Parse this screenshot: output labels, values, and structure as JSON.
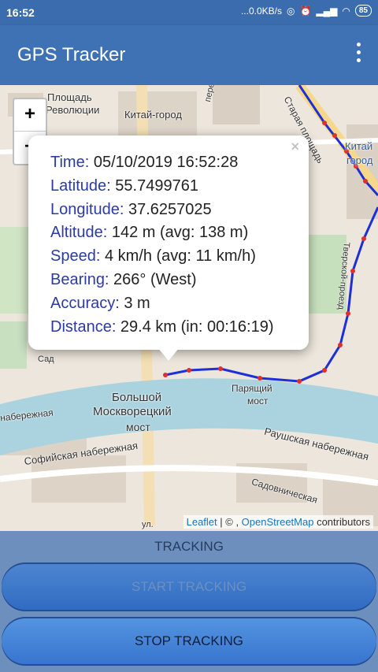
{
  "status_bar": {
    "time": "16:52",
    "net_speed": "...0.0KB/s",
    "battery": "85"
  },
  "app_bar": {
    "title": "GPS Tracker"
  },
  "map": {
    "zoom_in_label": "+",
    "zoom_out_label": "−",
    "labels": {
      "ploshchad": "Площадь",
      "revolyutsii": "Революции",
      "kitay_gorod": "Китай-город",
      "pereulok": "переулок",
      "staraya": "Старая площадь",
      "kitay_right": "Китай",
      "gorod_right": "город",
      "tversk": "Тверской-проезд",
      "sad": "Сад",
      "bolshoy": "Большой",
      "moskvoretsky": "Москворецкий",
      "most": "мост",
      "paryashchiy": "Парящий",
      "most2": "мост",
      "naberezhnaya_left": "набережная",
      "sofiyskaya": "Софийская набережная",
      "raushskaya": "Раушская набережная",
      "sadovnicheskaya": "Садовническая",
      "ulitsa": "ул."
    },
    "attribution": {
      "leaflet": "Leaflet",
      "separator": " | © , ",
      "osm": "OpenStreetMap",
      "contributors": " contributors"
    },
    "popup": {
      "close": "×",
      "rows": [
        {
          "key": "Time:",
          "value": " 05/10/2019 16:52:28"
        },
        {
          "key": "Latitude:",
          "value": " 55.7499761"
        },
        {
          "key": "Longitude:",
          "value": " 37.6257025"
        },
        {
          "key": "Altitude:",
          "value": " 142 m (avg: 138 m)"
        },
        {
          "key": "Speed:",
          "value": " 4 km/h (avg: 11 km/h)"
        },
        {
          "key": "Bearing:",
          "value": " 266° (West)"
        },
        {
          "key": "Accuracy:",
          "value": " 3 m"
        },
        {
          "key": "Distance:",
          "value": " 29.4 km (in: 00:16:19)"
        }
      ]
    },
    "track_color": "#1e2fd6",
    "point_color": "#e0302a"
  },
  "tracking": {
    "label": "TRACKING",
    "start_label": "START TRACKING",
    "stop_label": "STOP TRACKING"
  }
}
